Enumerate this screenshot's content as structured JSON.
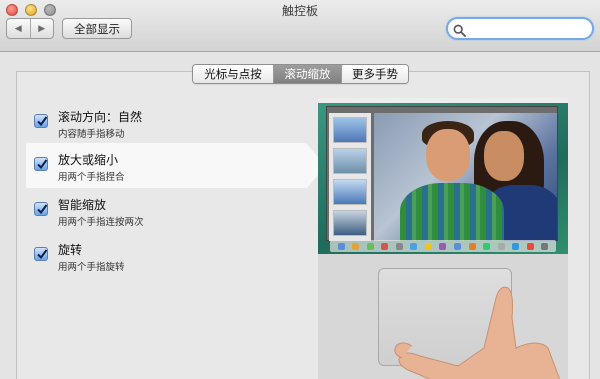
{
  "window": {
    "title": "触控板"
  },
  "toolbar": {
    "back_glyph": "◀",
    "forward_glyph": "▶",
    "show_all_label": "全部显示",
    "search_placeholder": "",
    "search_value": ""
  },
  "tabs": [
    {
      "label": "光标与点按",
      "selected": false
    },
    {
      "label": "滚动缩放",
      "selected": true
    },
    {
      "label": "更多手势",
      "selected": false
    }
  ],
  "options": [
    {
      "title": "滚动方向：自然",
      "subtitle": "内容随手指移动",
      "checked": true,
      "selected": false
    },
    {
      "title": "放大或缩小",
      "subtitle": "用两个手指捏合",
      "checked": true,
      "selected": true
    },
    {
      "title": "智能缩放",
      "subtitle": "用两个手指连按两次",
      "checked": true,
      "selected": false
    },
    {
      "title": "旋转",
      "subtitle": "用两个手指旋转",
      "checked": true,
      "selected": false
    }
  ],
  "colors": {
    "checkbox_accent": "#5f9ae6",
    "search_focus_ring": "#76a9e6",
    "selected_tab": "#8c8c8c"
  },
  "icons": {
    "close": "close-icon",
    "minimize": "minimize-icon",
    "zoom": "zoom-icon",
    "search": "search-icon",
    "check": "checkmark-icon"
  }
}
